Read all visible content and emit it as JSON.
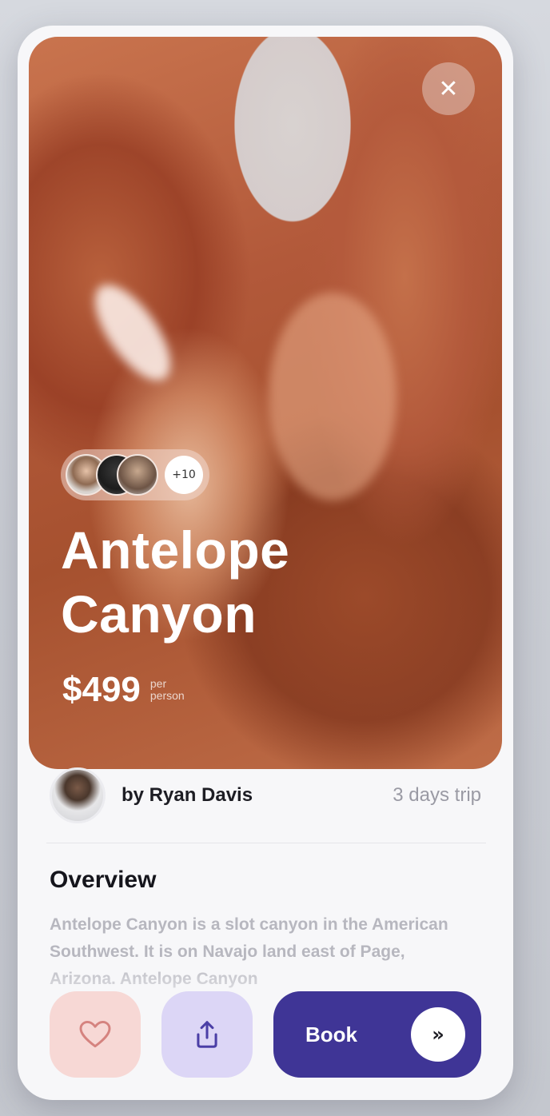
{
  "hero": {
    "title_line1": "Antelope",
    "title_line2": "Canyon",
    "price": "$499",
    "price_unit_line1": "per",
    "price_unit_line2": "person",
    "extra_travelers": "+10",
    "close_icon": "close-icon"
  },
  "author": {
    "name": "by Ryan Davis",
    "trip_length": "3 days trip"
  },
  "overview": {
    "heading": "Overview",
    "text": "Antelope Canyon is a slot canyon in the American Southwest. It is on Navajo land east of Page, Arizona. Antelope Canyon"
  },
  "actions": {
    "like_icon": "heart-icon",
    "share_icon": "share-icon",
    "book_label": "Book",
    "book_arrow_icon": "double-chevron-right-icon",
    "book_arrow_glyph": "»"
  },
  "colors": {
    "accent": "#3f3596",
    "like_bg": "#f7d8d5",
    "share_bg": "#dcd6f6"
  }
}
